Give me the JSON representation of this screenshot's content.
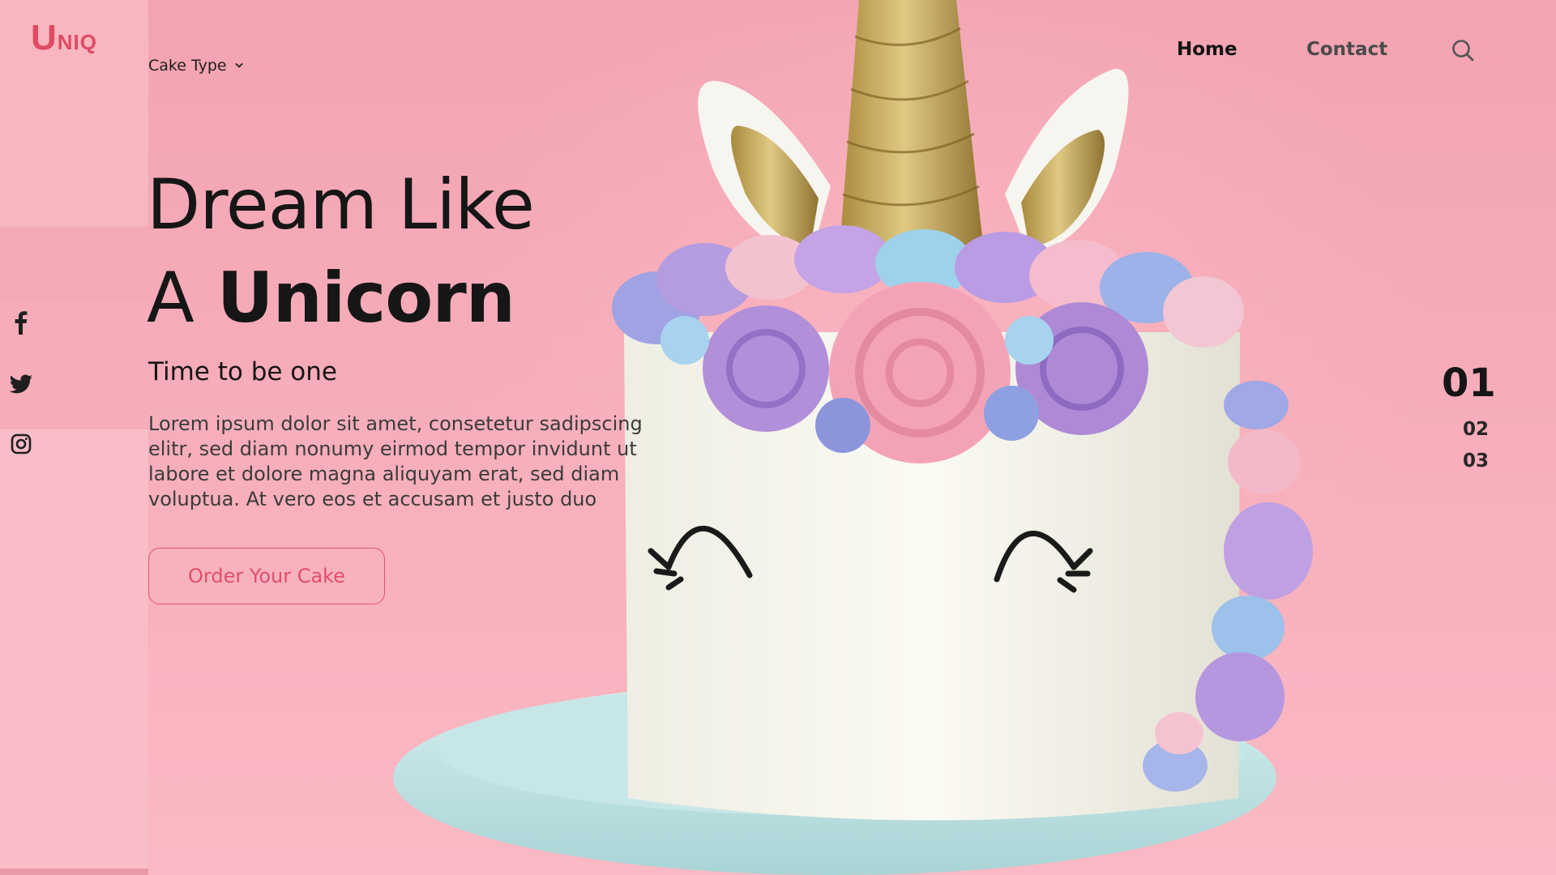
{
  "brand": {
    "logo_initial": "U",
    "logo_rest": "NIQ",
    "accent": "#e04a63"
  },
  "header": {
    "dropdown_label": "Cake Type",
    "nav": [
      {
        "label": "Home",
        "active": true
      },
      {
        "label": "Contact",
        "active": false
      }
    ],
    "search_icon": "search-icon"
  },
  "hero": {
    "title_line1": "Dream Like",
    "title_line2_regular": "A",
    "title_line2_bold": "Unicorn",
    "subtitle": "Time to be one",
    "body": "Lorem ipsum dolor sit amet, consetetur sadipscing elitr, sed diam nonumy eirmod tempor invidunt ut labore et dolore magna aliquyam erat, sed diam voluptua. At vero eos et accusam et justo duo",
    "cta_label": "Order Your Cake"
  },
  "social": [
    "facebook-icon",
    "twitter-icon",
    "instagram-icon"
  ],
  "slider": {
    "current": "01",
    "items": [
      "02",
      "03"
    ]
  },
  "colors": {
    "background": "#f6a9b6",
    "rail": "#f8b6c1",
    "text": "#161616",
    "cta": "#e0506a"
  }
}
